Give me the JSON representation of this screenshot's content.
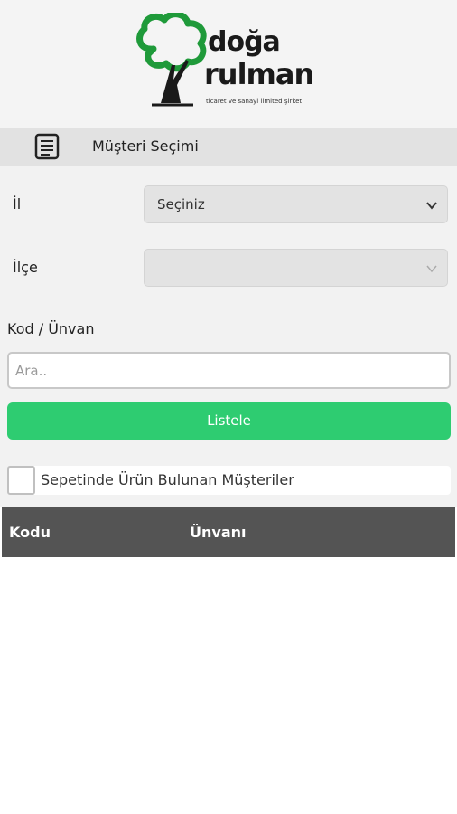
{
  "brand": {
    "line1": "doğa",
    "line2": "rulman",
    "tagline": "ticaret ve sanayi limited şirket"
  },
  "navbar": {
    "icon": "list-icon",
    "title": "Müşteri Seçimi"
  },
  "form": {
    "il_label": "İl",
    "il_value": "Seçiniz",
    "ilce_label": "İlçe",
    "ilce_value": "",
    "kod_label": "Kod / Ünvan",
    "search_placeholder": "Ara..",
    "search_value": "",
    "list_button": "Listele",
    "checkbox_label": "Sepetinde Ürün Bulunan Müşteriler",
    "checkbox_checked": false
  },
  "table": {
    "columns": [
      "Kodu",
      "Ünvanı"
    ],
    "rows": []
  },
  "colors": {
    "accent_green": "#2ecc71",
    "logo_green": "#1f9a3a",
    "table_header": "#545454"
  }
}
